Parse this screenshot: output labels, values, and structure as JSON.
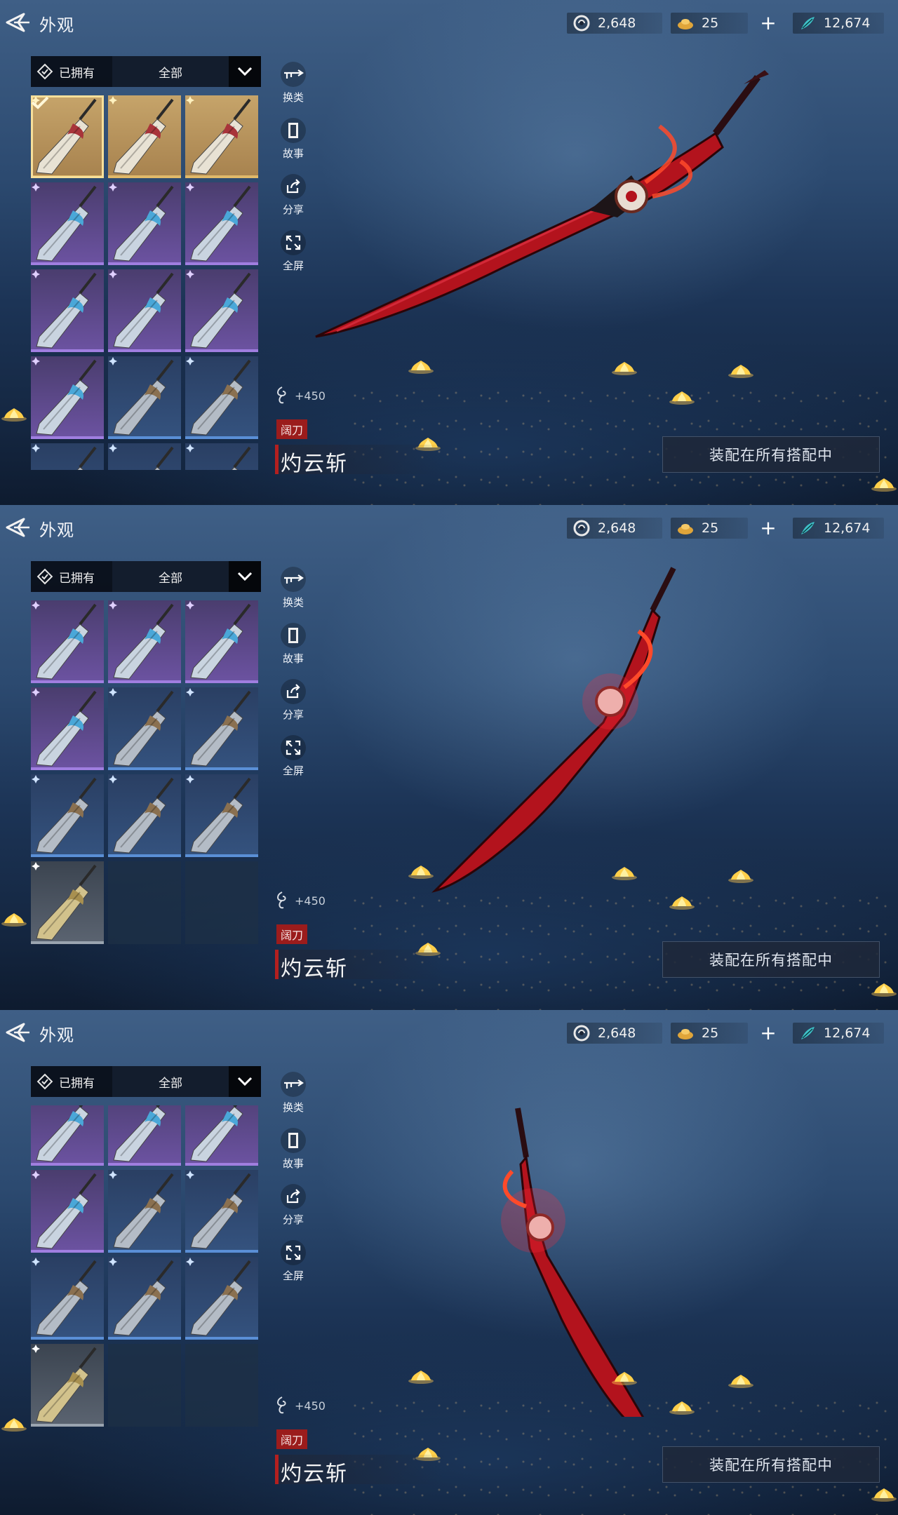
{
  "header": {
    "title": "外观",
    "currencies": [
      {
        "icon": "jade-coin-icon",
        "value": "2,648"
      },
      {
        "icon": "gold-ingot-icon",
        "value": "25"
      },
      {
        "icon": "feather-token-icon",
        "value": "12,674"
      }
    ],
    "add_label": "+"
  },
  "filters": {
    "owned_label": "已拥有",
    "category_value": "全部"
  },
  "actions": [
    {
      "icon": "swap-weapon-icon",
      "label": "换类"
    },
    {
      "icon": "book-icon",
      "label": "故事"
    },
    {
      "icon": "share-icon",
      "label": "分享"
    },
    {
      "icon": "fullscreen-icon",
      "label": "全屏"
    }
  ],
  "weapon": {
    "power": "+450",
    "type": "阔刀",
    "name": "灼云斩"
  },
  "equip_button": "装配在所有搭配中",
  "colors": {
    "gold": "#c6a46a",
    "purple": "#6b52a0",
    "blue": "#34527e",
    "grey": "#5a6370",
    "accent_red": "#9b1c1c",
    "blade_red": "#c2101a"
  },
  "panels": [
    {
      "weapon_pose": "diagonal-wide",
      "tiles": [
        "gold-selected",
        "gold",
        "gold",
        "purple",
        "purple",
        "purple",
        "purple",
        "purple",
        "purple",
        "purple",
        "blue",
        "blue",
        "blue",
        "blue",
        "blue"
      ]
    },
    {
      "weapon_pose": "diagonal-steep",
      "tiles": [
        "purple",
        "purple",
        "purple",
        "purple",
        "blue",
        "blue",
        "blue",
        "blue",
        "blue",
        "grey",
        "empty",
        "empty"
      ]
    },
    {
      "weapon_pose": "vertical",
      "tiles": [
        "purple",
        "purple",
        "purple",
        "purple",
        "blue",
        "blue",
        "blue",
        "blue",
        "blue",
        "grey",
        "empty",
        "empty"
      ]
    }
  ]
}
